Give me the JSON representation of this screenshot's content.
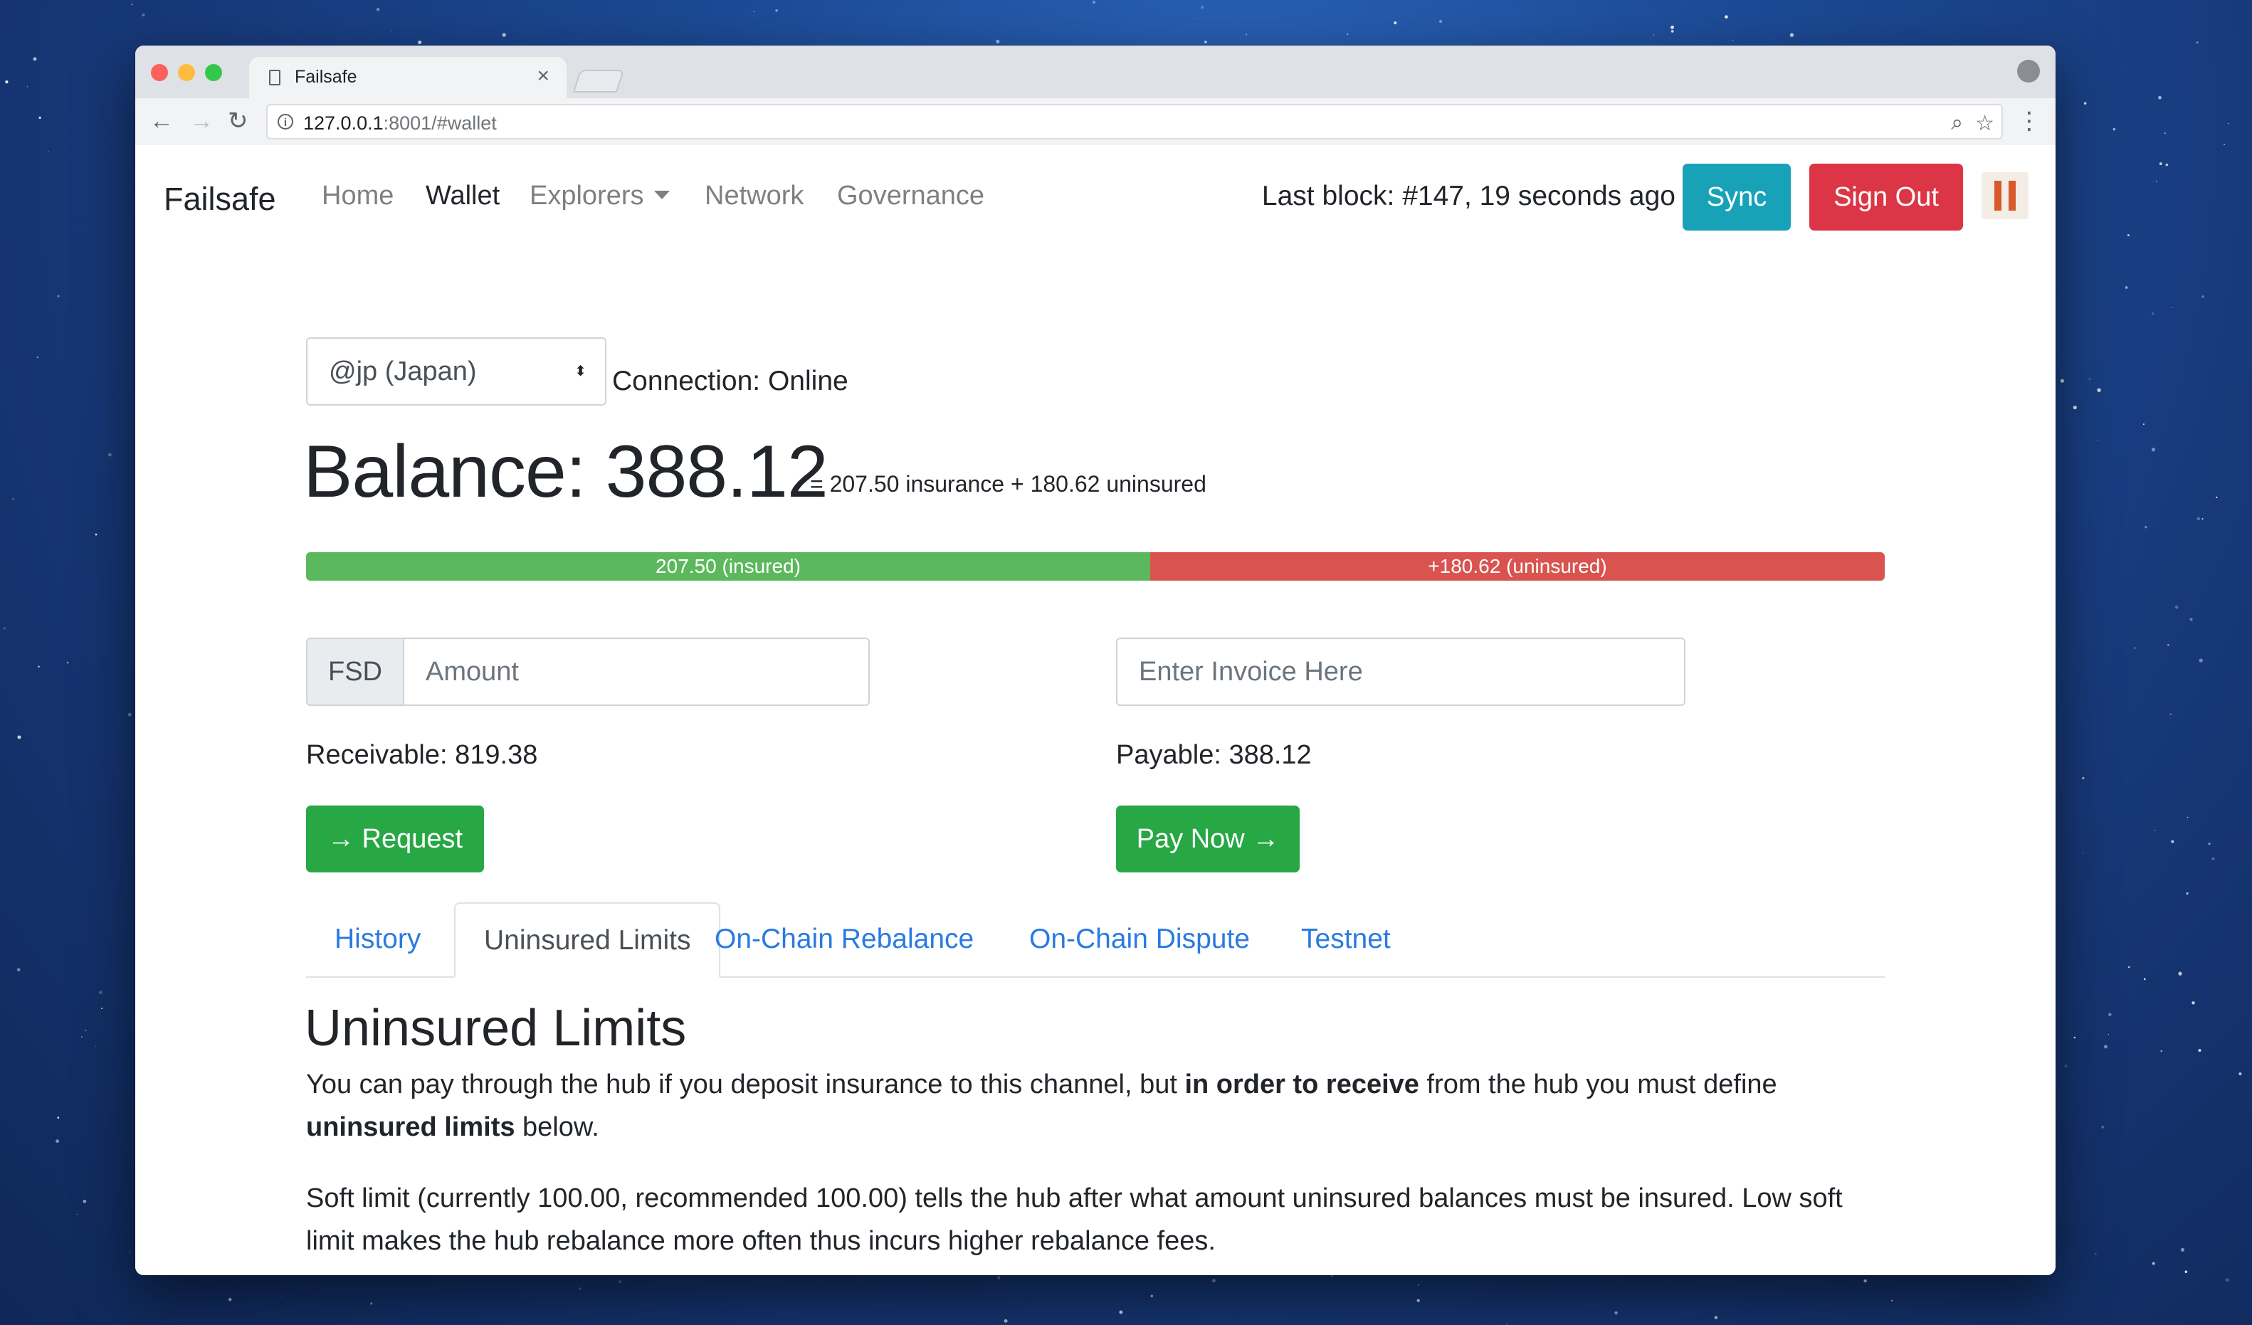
{
  "browser": {
    "tab_title": "Failsafe",
    "tab_close": "×",
    "url_host": "127.0.0.1",
    "url_rest": ":8001/#wallet"
  },
  "navbar": {
    "brand": "Failsafe",
    "links": [
      "Home",
      "Wallet",
      "Explorers",
      "Network",
      "Governance"
    ],
    "active_link": "Wallet",
    "last_block": "Last block: #147, 19 seconds ago",
    "sync_label": "Sync",
    "signout_label": "Sign Out"
  },
  "wallet": {
    "hub_selected": "@jp (Japan)",
    "connection": "Connection: Online",
    "balance": "Balance: 388.12",
    "balance_breakdown": "= 207.50 insurance + 180.62 uninsured",
    "insured_label": "207.50 (insured)",
    "uninsured_label": "+180.62 (uninsured)",
    "insured_value": 207.5,
    "uninsured_value": 180.62,
    "currency": "FSD",
    "amount_placeholder": "Amount",
    "invoice_placeholder": "Enter Invoice Here",
    "receivable": "Receivable: 819.38",
    "payable": "Payable: 388.12",
    "request_label": "→ Request",
    "paynow_label": "Pay Now →"
  },
  "tabs": {
    "items": [
      "History",
      "Uninsured Limits",
      "On-Chain Rebalance",
      "On-Chain Dispute",
      "Testnet"
    ],
    "active": "Uninsured Limits"
  },
  "content": {
    "heading": "Uninsured Limits",
    "p1_a": "You can pay through the hub if you deposit insurance to this channel, but ",
    "p1_b": "in order to receive",
    "p1_c": " from the hub you must define ",
    "p1_d": "uninsured limits",
    "p1_e": " below.",
    "p2": "Soft limit (currently 100.00, recommended 100.00) tells the hub after what amount uninsured balances must be insured. Low soft limit makes the hub rebalance more often thus incurs higher rebalance fees.",
    "soft_limit_value": "100"
  }
}
